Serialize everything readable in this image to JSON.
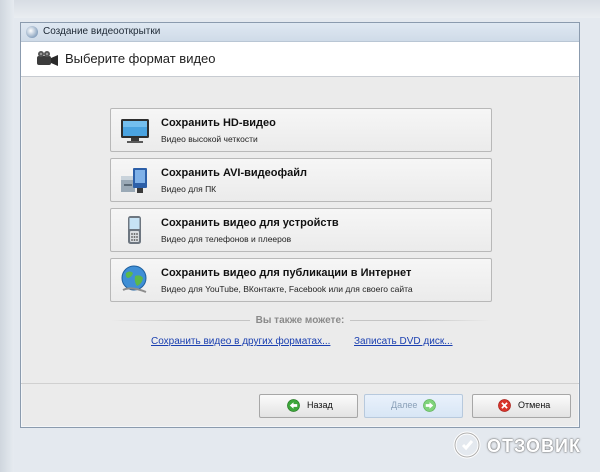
{
  "window": {
    "title": "Создание видеооткрытки",
    "heading": "Выберите формат видео"
  },
  "options": [
    {
      "title": "Сохранить HD-видео",
      "subtitle": "Видео высокой четкости",
      "icon": "tv-icon"
    },
    {
      "title": "Сохранить AVI-видеофайл",
      "subtitle": "Видео для ПК",
      "icon": "avi-file-icon"
    },
    {
      "title": "Сохранить видео для устройств",
      "subtitle": "Видео для телефонов и плееров",
      "icon": "mobile-phone-icon"
    },
    {
      "title": "Сохранить видео для публикации в Интернет",
      "subtitle": "Видео для YouTube, ВКонтакте, Facebook или для своего сайта",
      "icon": "globe-icon"
    }
  ],
  "also": {
    "label": "Вы также можете:",
    "links": [
      "Сохранить видео в других форматах...",
      "Записать DVD диск..."
    ]
  },
  "buttons": {
    "back": "Назад",
    "next": "Далее",
    "cancel": "Отмена"
  },
  "watermark": {
    "text": "ОТЗОВИК"
  },
  "colors": {
    "link": "#1a3fb0",
    "back_icon": "#3ca63a",
    "next_icon": "#7fd37a",
    "cancel_icon": "#d9342b"
  }
}
